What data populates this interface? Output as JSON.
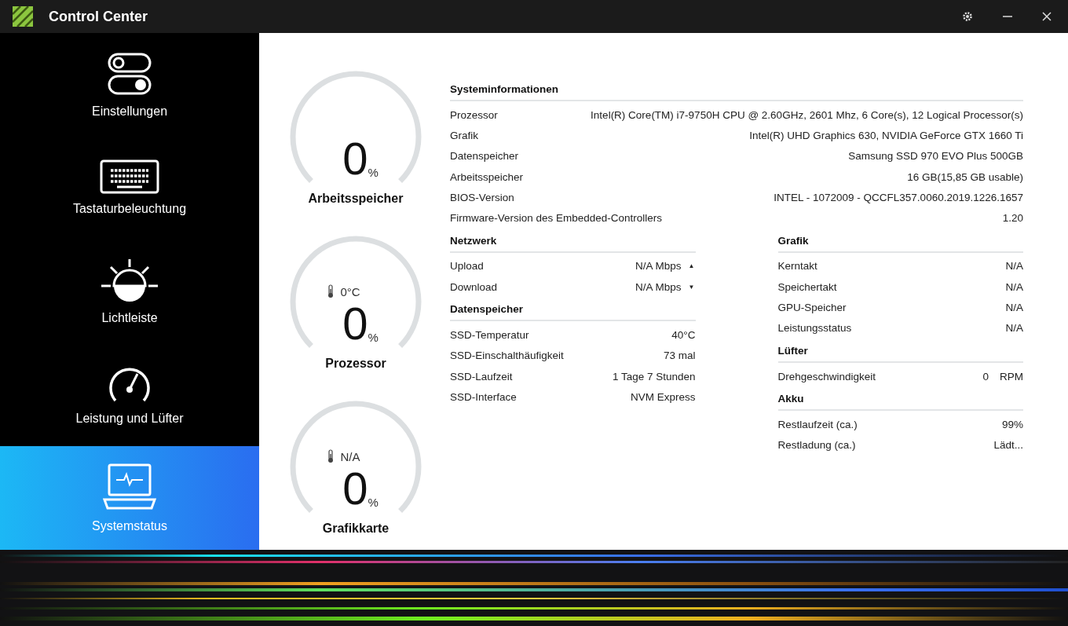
{
  "window": {
    "title": "Control Center"
  },
  "sidebar": {
    "items": [
      {
        "label": "Einstellungen",
        "selected": false
      },
      {
        "label": "Tastaturbeleuchtung",
        "selected": false
      },
      {
        "label": "Lichtleiste",
        "selected": false
      },
      {
        "label": "Leistung und Lüfter",
        "selected": false
      },
      {
        "label": "Systemstatus",
        "selected": true
      }
    ]
  },
  "gauges": [
    {
      "label": "Arbeitsspeicher",
      "value": "0",
      "unit": "%"
    },
    {
      "label": "Prozessor",
      "temperature": "0°C",
      "value": "0",
      "unit": "%"
    },
    {
      "label": "Grafikkarte",
      "temperature": "N/A",
      "value": "0",
      "unit": "%"
    }
  ],
  "system_info": {
    "title": "Systeminformationen",
    "rows": [
      {
        "label": "Prozessor",
        "value": "Intel(R) Core(TM) i7-9750H CPU @ 2.60GHz, 2601 Mhz, 6 Core(s), 12 Logical Processor(s)"
      },
      {
        "label": "Grafik",
        "value": "Intel(R) UHD Graphics 630, NVIDIA GeForce GTX 1660 Ti"
      },
      {
        "label": "Datenspeicher",
        "value": "Samsung SSD 970 EVO Plus 500GB"
      },
      {
        "label": "Arbeitsspeicher",
        "value": "16 GB(15,85 GB usable)"
      },
      {
        "label": "BIOS-Version",
        "value": "INTEL  - 1072009 - QCCFL357.0060.2019.1226.1657"
      },
      {
        "label": "Firmware-Version des Embedded-Controllers",
        "value": "1.20"
      }
    ]
  },
  "left_sections": [
    {
      "title": "Netzwerk",
      "rows": [
        {
          "label": "Upload",
          "value": "N/A Mbps",
          "arrow": "▲"
        },
        {
          "label": "Download",
          "value": "N/A Mbps",
          "arrow": "▼"
        }
      ]
    },
    {
      "title": "Datenspeicher",
      "rows": [
        {
          "label": "SSD-Temperatur",
          "value": "40°C"
        },
        {
          "label": "SSD-Einschalthäufigkeit",
          "value": "73 mal"
        },
        {
          "label": "SSD-Laufzeit",
          "value": "1 Tage 7 Stunden"
        },
        {
          "label": "SSD-Interface",
          "value": "NVM Express"
        }
      ]
    }
  ],
  "right_sections": [
    {
      "title": "Grafik",
      "rows": [
        {
          "label": "Kerntakt",
          "value": "N/A"
        },
        {
          "label": "Speichertakt",
          "value": "N/A"
        },
        {
          "label": "GPU-Speicher",
          "value": "N/A"
        },
        {
          "label": "Leistungsstatus",
          "value": "N/A"
        }
      ]
    },
    {
      "title": "Lüfter",
      "rows": [
        {
          "label": "Drehgeschwindigkeit",
          "value": "0",
          "unit": "RPM"
        }
      ]
    },
    {
      "title": "Akku",
      "rows": [
        {
          "label": "Restlaufzeit (ca.)",
          "value": "99%"
        },
        {
          "label": "Restladung (ca.)",
          "value": "Lädt..."
        }
      ]
    }
  ]
}
